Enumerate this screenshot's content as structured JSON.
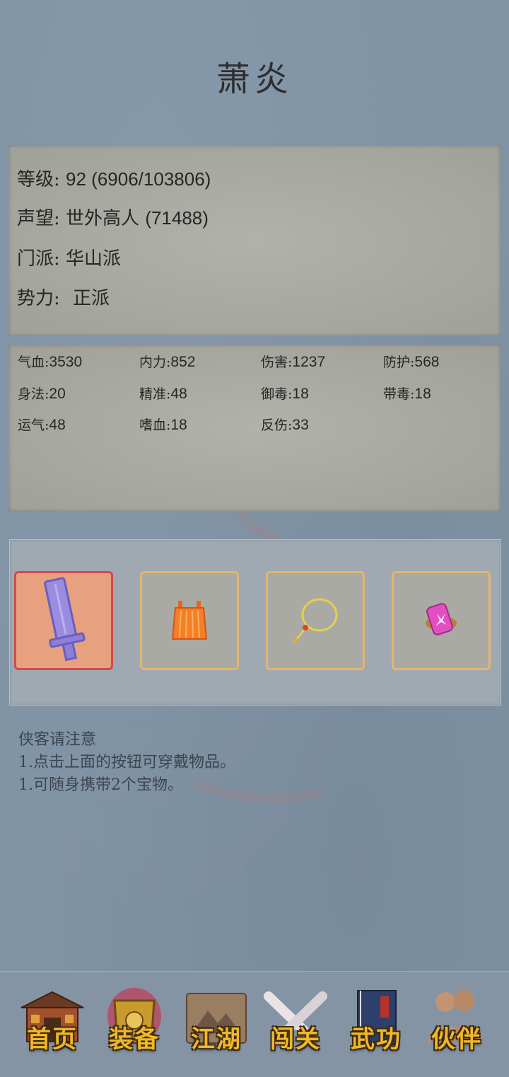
{
  "character": {
    "name": "萧炎"
  },
  "info": {
    "level_label": "等级:",
    "level_value": "92 (6906/103806)",
    "reputation_label": "声望:",
    "reputation_title": "世外高人",
    "reputation_value": "(71488)",
    "sect_label": "门派:",
    "sect_value": "华山派",
    "faction_label": "势力:",
    "faction_value": "正派"
  },
  "stats": [
    {
      "label": "气血:",
      "value": "3530"
    },
    {
      "label": "内力:",
      "value": "852"
    },
    {
      "label": "伤害:",
      "value": "1237"
    },
    {
      "label": "防护:",
      "value": "568"
    },
    {
      "label": "身法:",
      "value": "20"
    },
    {
      "label": "精准:",
      "value": "48"
    },
    {
      "label": "御毒:",
      "value": "18"
    },
    {
      "label": "带毒:",
      "value": "18"
    },
    {
      "label": "运气:",
      "value": "48"
    },
    {
      "label": "嗜血:",
      "value": "18"
    },
    {
      "label": "反伤:",
      "value": "33"
    }
  ],
  "equipment_slots": [
    {
      "icon": "sword-icon",
      "selected": true
    },
    {
      "icon": "armor-icon",
      "selected": false
    },
    {
      "icon": "necklace-icon",
      "selected": false
    },
    {
      "icon": "gem-icon",
      "selected": false
    }
  ],
  "notes": {
    "title": "侠客请注意",
    "line1": "1.点击上面的按钮可穿戴物品。",
    "line2": "1.可随身携带2个宝物。"
  },
  "nav": [
    {
      "label": "首页",
      "icon": "house-icon"
    },
    {
      "label": "装备",
      "icon": "armor-icon",
      "active": true
    },
    {
      "label": "江湖",
      "icon": "scroll-map-icon"
    },
    {
      "label": "闯关",
      "icon": "crossed-swords-icon"
    },
    {
      "label": "武功",
      "icon": "book-icon"
    },
    {
      "label": "伙伴",
      "icon": "people-icon"
    }
  ],
  "colors": {
    "background": "#7f93a5",
    "panel": "#a8aaa1",
    "slot_border": "#e3b56f",
    "slot_selected_bg": "#e7a17f",
    "nav_label": "#f0b728"
  }
}
